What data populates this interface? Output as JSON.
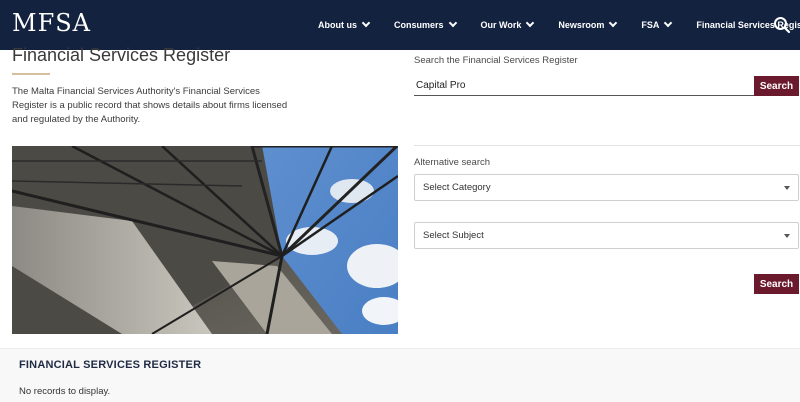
{
  "header": {
    "logo_text": "MFSA",
    "nav": [
      {
        "label": "About us",
        "has_dropdown": true
      },
      {
        "label": "Consumers",
        "has_dropdown": true
      },
      {
        "label": "Our Work",
        "has_dropdown": true
      },
      {
        "label": "Newsroom",
        "has_dropdown": true
      },
      {
        "label": "FSA",
        "has_dropdown": true
      },
      {
        "label": "Financial Services Register",
        "has_dropdown": false
      }
    ],
    "search_icon": "search-icon",
    "background_color": "#13223f"
  },
  "intro": {
    "title": "Financial Services Register",
    "description": "The Malta Financial Services Authority's Financial Services Register is a public record that shows details about firms licensed and regulated by the Authority."
  },
  "search": {
    "label": "Search the Financial Services Register",
    "value": "Capital Pro",
    "button_label": "Search"
  },
  "alternative_search": {
    "label": "Alternative search",
    "category_select": "Select Category",
    "subject_select": "Select Subject",
    "button_label": "Search"
  },
  "results": {
    "title": "FINANCIAL SERVICES REGISTER",
    "empty_message": "No records to display."
  },
  "colors": {
    "accent": "#6b1a2e",
    "title_rule": "#d8bf9b"
  }
}
